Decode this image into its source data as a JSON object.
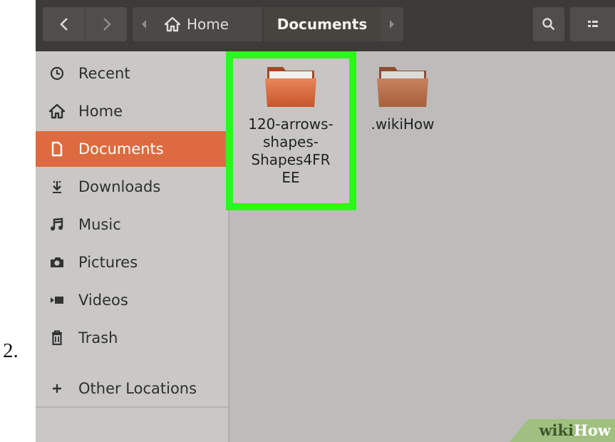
{
  "step_number": "2.",
  "headerbar": {
    "back_icon": "chevron-left-icon",
    "forward_icon": "chevron-right-icon",
    "path_left_icon": "caret-left-icon",
    "path_right_icon": "caret-right-icon",
    "home_crumb": "Home",
    "current_crumb": "Documents",
    "search_icon": "search-icon",
    "view_icon": "list-view-icon"
  },
  "sidebar": {
    "items": [
      {
        "label": "Recent",
        "icon": "clock-icon"
      },
      {
        "label": "Home",
        "icon": "home-icon"
      },
      {
        "label": "Documents",
        "icon": "document-icon",
        "selected": true
      },
      {
        "label": "Downloads",
        "icon": "download-icon"
      },
      {
        "label": "Music",
        "icon": "music-icon"
      },
      {
        "label": "Pictures",
        "icon": "camera-icon"
      },
      {
        "label": "Videos",
        "icon": "video-icon"
      },
      {
        "label": "Trash",
        "icon": "trash-icon"
      },
      {
        "label": "Other Locations",
        "icon": "plus-icon"
      }
    ]
  },
  "content": {
    "folders": [
      {
        "lines": [
          "120-arrows-",
          "shapes-",
          "Shapes4FR",
          "EE"
        ],
        "highlighted": true
      },
      {
        "lines": [
          ".wikiHow"
        ],
        "highlighted": false
      }
    ]
  },
  "watermark": {
    "wiki": "wiki",
    "how": "How"
  },
  "colors": {
    "accent": "#dd6b3f",
    "highlight": "#2ff61a",
    "headerbar": "#3c3b37",
    "sidebar": "#c9c8c6",
    "content": "#bdbcbb"
  }
}
